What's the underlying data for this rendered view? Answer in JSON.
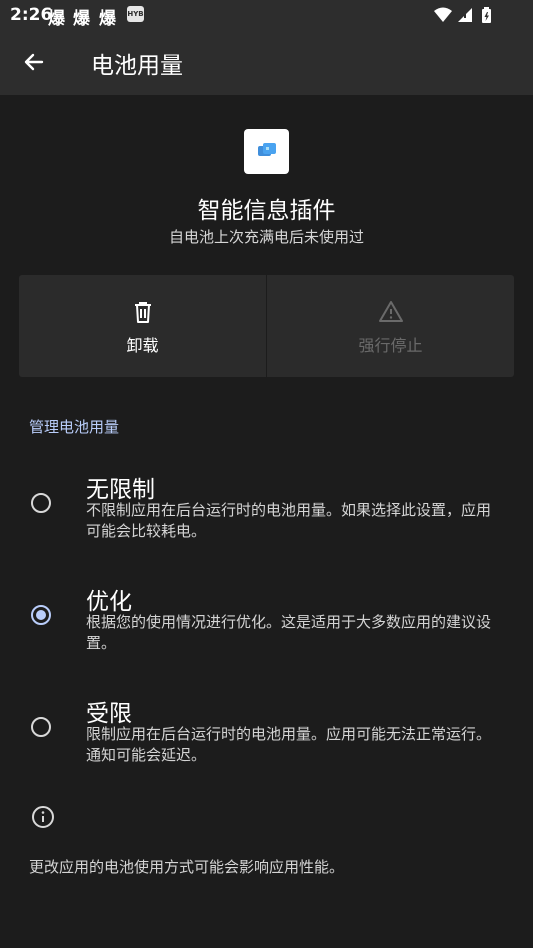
{
  "status_bar": {
    "time": "2:26",
    "notification_glyphs": [
      "爆",
      "爆",
      "爆"
    ],
    "notification_box": "HYB",
    "icons": [
      "wifi-icon",
      "signal-icon",
      "battery-icon"
    ]
  },
  "app_bar": {
    "back_icon": "arrow-back-icon",
    "title": "电池用量"
  },
  "app_info": {
    "icon": "messaging-plugin-icon",
    "name": "智能信息插件",
    "subtitle": "自电池上次充满电后未使用过"
  },
  "actions": {
    "uninstall": {
      "icon": "trash-icon",
      "label": "卸载"
    },
    "force_stop": {
      "icon": "warning-icon",
      "label": "强行停止"
    }
  },
  "battery_section": {
    "header": "管理电池用量",
    "options": [
      {
        "title": "无限制",
        "description": "不限制应用在后台运行时的电池用量。如果选择此设置，应用可能会比较耗电。",
        "selected": false
      },
      {
        "title": "优化",
        "description": "根据您的使用情况进行优化。这是适用于大多数应用的建议设置。",
        "selected": true
      },
      {
        "title": "受限",
        "description": "限制应用在后台运行时的电池用量。应用可能无法正常运行。通知可能会延迟。",
        "selected": false
      }
    ]
  },
  "footer": {
    "icon": "info-icon",
    "text": "更改应用的电池使用方式可能会影响应用性能。"
  },
  "colors": {
    "background": "#1c1c1c",
    "app_bar": "#2d2d2d",
    "accent": "#b9cdfa",
    "disabled": "#6a6a6a"
  }
}
